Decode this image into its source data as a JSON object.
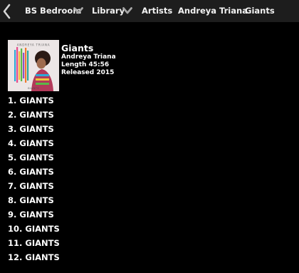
{
  "nav": {
    "back_icon": "chevron-left-icon",
    "breadcrumbs": [
      {
        "label": "BS Bedroom",
        "icon_after": "chevron-down-icon"
      },
      {
        "label": "Library",
        "icon_after": "chevron-down-icon"
      },
      {
        "label": "Artists"
      },
      {
        "label": "Andreya Triana"
      },
      {
        "label": "Giants"
      }
    ],
    "colors": {
      "bar": "#1d1d1d",
      "icon": "#a6a6a6",
      "text": "#f2f2f2"
    }
  },
  "album": {
    "title": "Giants",
    "artist": "Andreya Triana",
    "length": "Length 45:56",
    "released": "Released 2015",
    "cover_text": "ANDREYA TRIANA",
    "cover_subtitle": "GIANTS"
  },
  "tracks": [
    {
      "num": "1.",
      "name": "GIANTS"
    },
    {
      "num": "2.",
      "name": "GIANTS"
    },
    {
      "num": "3.",
      "name": "GIANTS"
    },
    {
      "num": "4.",
      "name": "GIANTS"
    },
    {
      "num": "5.",
      "name": "GIANTS"
    },
    {
      "num": "6.",
      "name": "GIANTS"
    },
    {
      "num": "7.",
      "name": "GIANTS"
    },
    {
      "num": "8.",
      "name": "GIANTS"
    },
    {
      "num": "9.",
      "name": "GIANTS"
    },
    {
      "num": "10.",
      "name": "GIANTS"
    },
    {
      "num": "11.",
      "name": "GIANTS"
    },
    {
      "num": "12.",
      "name": "GIANTS"
    }
  ]
}
